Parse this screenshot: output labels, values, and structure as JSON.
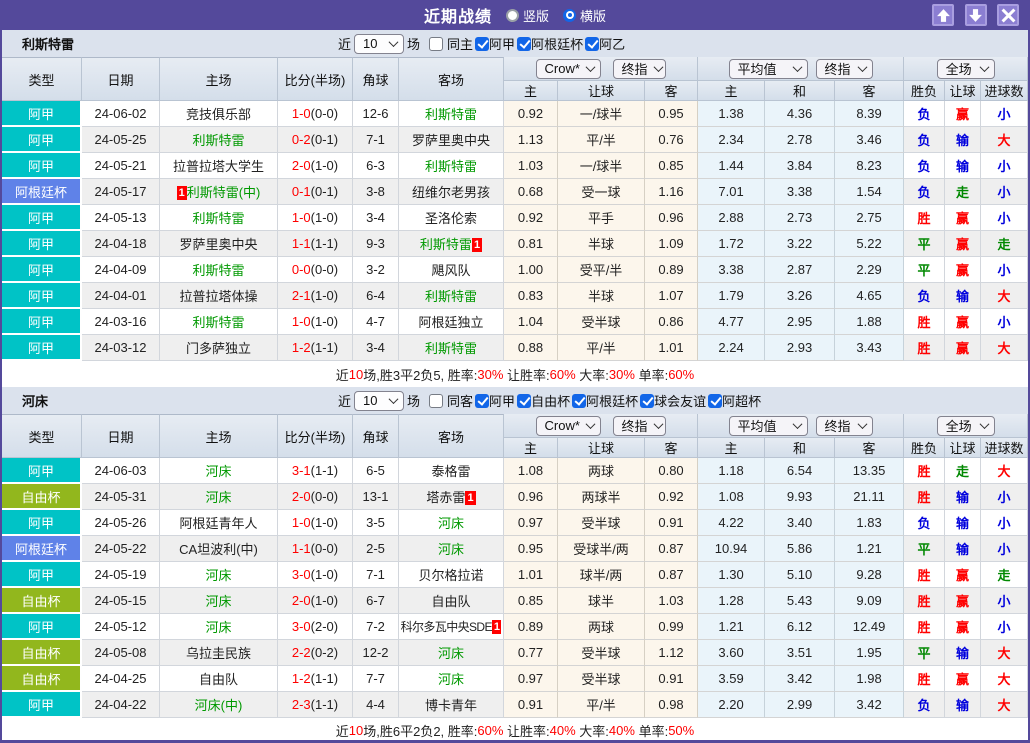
{
  "titlebar": {
    "title": "近期战绩",
    "radios": [
      {
        "label": "竖版",
        "checked": false
      },
      {
        "label": "横版",
        "checked": true
      }
    ],
    "buttons": {
      "up": "up-arrow",
      "down": "down-arrow",
      "close": "close-x"
    }
  },
  "palette": {
    "accent_purple": "#54499b",
    "league_cyan": "#00c3c6",
    "league_blue": "#5f82e8",
    "league_olive": "#92b71d",
    "red": "#ff0000",
    "blue": "#0000dd",
    "green": "#008800",
    "team_green": "#009900"
  },
  "table_header": {
    "league": "类型",
    "date": "日期",
    "home": "主场",
    "score": "比分(半场)",
    "corner": "角球",
    "away": "客场",
    "crow_cols": [
      "主",
      "让球",
      "客"
    ],
    "avg_cols": [
      "主",
      "和",
      "客"
    ],
    "res_cols": [
      "胜负",
      "让球",
      "进球数"
    ]
  },
  "filters_common": {
    "prefix": "近",
    "count": "10",
    "suffix": "场"
  },
  "selects": {
    "odds_source": "Crow*",
    "odds_stage": "终指",
    "euro_source": "平均值",
    "euro_stage": "终指",
    "scope": "全场"
  },
  "sections": [
    {
      "team": "利斯特雷",
      "checkboxes": [
        {
          "label": "同主",
          "checked": false
        },
        {
          "label": "阿甲",
          "checked": true
        },
        {
          "label": "阿根廷杯",
          "checked": true
        },
        {
          "label": "阿乙",
          "checked": true
        }
      ],
      "rows": [
        {
          "league": "阿甲",
          "lc": "league_cyan",
          "date": "24-06-02",
          "home": {
            "name": "竞技俱乐部"
          },
          "score": "1-0",
          "half": "(0-0)",
          "corner": "12-6",
          "away": {
            "name": "利斯特雷",
            "hl": true
          },
          "crow": [
            "0.92",
            "一/球半",
            "0.95"
          ],
          "avg": [
            "1.38",
            "4.36",
            "8.39"
          ],
          "res": [
            [
              "负",
              "blue"
            ],
            [
              "赢",
              "red"
            ],
            [
              "小",
              "blue"
            ]
          ]
        },
        {
          "league": "阿甲",
          "lc": "league_cyan",
          "date": "24-05-25",
          "home": {
            "name": "利斯特雷",
            "hl": true
          },
          "score": "0-2",
          "half": "(0-1)",
          "corner": "7-1",
          "away": {
            "name": "罗萨里奥中央"
          },
          "crow": [
            "1.13",
            "平/半",
            "0.76"
          ],
          "avg": [
            "2.34",
            "2.78",
            "3.46"
          ],
          "res": [
            [
              "负",
              "blue"
            ],
            [
              "输",
              "blue"
            ],
            [
              "大",
              "red"
            ]
          ]
        },
        {
          "league": "阿甲",
          "lc": "league_cyan",
          "date": "24-05-21",
          "home": {
            "name": "拉普拉塔大学生"
          },
          "score": "2-0",
          "half": "(1-0)",
          "corner": "6-3",
          "away": {
            "name": "利斯特雷",
            "hl": true
          },
          "crow": [
            "1.03",
            "一/球半",
            "0.85"
          ],
          "avg": [
            "1.44",
            "3.84",
            "8.23"
          ],
          "res": [
            [
              "负",
              "blue"
            ],
            [
              "输",
              "blue"
            ],
            [
              "小",
              "blue"
            ]
          ]
        },
        {
          "league": "阿根廷杯",
          "lc": "league_blue",
          "date": "24-05-17",
          "home": {
            "name": "利斯特雷(中)",
            "hl": true,
            "badge_before": "1"
          },
          "score": "0-1",
          "half": "(0-1)",
          "corner": "3-8",
          "away": {
            "name": "纽维尔老男孩"
          },
          "crow": [
            "0.68",
            "受一球",
            "1.16"
          ],
          "avg": [
            "7.01",
            "3.38",
            "1.54"
          ],
          "res": [
            [
              "负",
              "blue"
            ],
            [
              "走",
              "green"
            ],
            [
              "小",
              "blue"
            ]
          ]
        },
        {
          "league": "阿甲",
          "lc": "league_cyan",
          "date": "24-05-13",
          "home": {
            "name": "利斯特雷",
            "hl": true
          },
          "score": "1-0",
          "half": "(1-0)",
          "corner": "3-4",
          "away": {
            "name": "圣洛伦索"
          },
          "crow": [
            "0.92",
            "平手",
            "0.96"
          ],
          "avg": [
            "2.88",
            "2.73",
            "2.75"
          ],
          "res": [
            [
              "胜",
              "red"
            ],
            [
              "赢",
              "red"
            ],
            [
              "小",
              "blue"
            ]
          ]
        },
        {
          "league": "阿甲",
          "lc": "league_cyan",
          "date": "24-04-18",
          "home": {
            "name": "罗萨里奥中央"
          },
          "score": "1-1",
          "half": "(1-1)",
          "corner": "9-3",
          "away": {
            "name": "利斯特雷",
            "hl": true,
            "badge_after": "1"
          },
          "crow": [
            "0.81",
            "半球",
            "1.09"
          ],
          "avg": [
            "1.72",
            "3.22",
            "5.22"
          ],
          "res": [
            [
              "平",
              "green"
            ],
            [
              "赢",
              "red"
            ],
            [
              "走",
              "green"
            ]
          ]
        },
        {
          "league": "阿甲",
          "lc": "league_cyan",
          "date": "24-04-09",
          "home": {
            "name": "利斯特雷",
            "hl": true
          },
          "score": "0-0",
          "half": "(0-0)",
          "corner": "3-2",
          "away": {
            "name": "飓风队"
          },
          "crow": [
            "1.00",
            "受平/半",
            "0.89"
          ],
          "avg": [
            "3.38",
            "2.87",
            "2.29"
          ],
          "res": [
            [
              "平",
              "green"
            ],
            [
              "赢",
              "red"
            ],
            [
              "小",
              "blue"
            ]
          ]
        },
        {
          "league": "阿甲",
          "lc": "league_cyan",
          "date": "24-04-01",
          "home": {
            "name": "拉普拉塔体操"
          },
          "score": "2-1",
          "half": "(1-0)",
          "corner": "6-4",
          "away": {
            "name": "利斯特雷",
            "hl": true
          },
          "crow": [
            "0.83",
            "半球",
            "1.07"
          ],
          "avg": [
            "1.79",
            "3.26",
            "4.65"
          ],
          "res": [
            [
              "负",
              "blue"
            ],
            [
              "输",
              "blue"
            ],
            [
              "大",
              "red"
            ]
          ]
        },
        {
          "league": "阿甲",
          "lc": "league_cyan",
          "date": "24-03-16",
          "home": {
            "name": "利斯特雷",
            "hl": true
          },
          "score": "1-0",
          "half": "(1-0)",
          "corner": "4-7",
          "away": {
            "name": "阿根廷独立"
          },
          "crow": [
            "1.04",
            "受半球",
            "0.86"
          ],
          "avg": [
            "4.77",
            "2.95",
            "1.88"
          ],
          "res": [
            [
              "胜",
              "red"
            ],
            [
              "赢",
              "red"
            ],
            [
              "小",
              "blue"
            ]
          ]
        },
        {
          "league": "阿甲",
          "lc": "league_cyan",
          "date": "24-03-12",
          "home": {
            "name": "门多萨独立"
          },
          "score": "1-2",
          "half": "(1-1)",
          "corner": "3-4",
          "away": {
            "name": "利斯特雷",
            "hl": true
          },
          "crow": [
            "0.88",
            "平/半",
            "1.01"
          ],
          "avg": [
            "2.24",
            "2.93",
            "3.43"
          ],
          "res": [
            [
              "胜",
              "red"
            ],
            [
              "赢",
              "red"
            ],
            [
              "大",
              "red"
            ]
          ]
        }
      ],
      "summary": [
        {
          "t": "近",
          "c": "black"
        },
        {
          "t": "10",
          "c": "red"
        },
        {
          "t": "场,胜3平2负5, 胜率:",
          "c": "black"
        },
        {
          "t": "30%",
          "c": "red"
        },
        {
          "t": " 让胜率:",
          "c": "black"
        },
        {
          "t": "60%",
          "c": "red"
        },
        {
          "t": " 大率:",
          "c": "black"
        },
        {
          "t": "30%",
          "c": "red"
        },
        {
          "t": " 单率:",
          "c": "black"
        },
        {
          "t": "60%",
          "c": "red"
        }
      ]
    },
    {
      "team": "河床",
      "checkboxes": [
        {
          "label": "同客",
          "checked": false
        },
        {
          "label": "阿甲",
          "checked": true
        },
        {
          "label": "自由杯",
          "checked": true
        },
        {
          "label": "阿根廷杯",
          "checked": true
        },
        {
          "label": "球会友谊",
          "checked": true
        },
        {
          "label": "阿超杯",
          "checked": true
        }
      ],
      "rows": [
        {
          "league": "阿甲",
          "lc": "league_cyan",
          "date": "24-06-03",
          "home": {
            "name": "河床",
            "hl": true
          },
          "score": "3-1",
          "half": "(1-1)",
          "corner": "6-5",
          "away": {
            "name": "泰格雷"
          },
          "crow": [
            "1.08",
            "两球",
            "0.80"
          ],
          "avg": [
            "1.18",
            "6.54",
            "13.35"
          ],
          "res": [
            [
              "胜",
              "red"
            ],
            [
              "走",
              "green"
            ],
            [
              "大",
              "red"
            ]
          ]
        },
        {
          "league": "自由杯",
          "lc": "league_olive",
          "date": "24-05-31",
          "home": {
            "name": "河床",
            "hl": true
          },
          "score": "2-0",
          "half": "(0-0)",
          "corner": "13-1",
          "away": {
            "name": "塔赤雷",
            "badge_after": "1"
          },
          "crow": [
            "0.96",
            "两球半",
            "0.92"
          ],
          "avg": [
            "1.08",
            "9.93",
            "21.11"
          ],
          "res": [
            [
              "胜",
              "red"
            ],
            [
              "输",
              "blue"
            ],
            [
              "小",
              "blue"
            ]
          ]
        },
        {
          "league": "阿甲",
          "lc": "league_cyan",
          "date": "24-05-26",
          "home": {
            "name": "阿根廷青年人"
          },
          "score": "1-0",
          "half": "(1-0)",
          "corner": "3-5",
          "away": {
            "name": "河床",
            "hl": true
          },
          "crow": [
            "0.97",
            "受半球",
            "0.91"
          ],
          "avg": [
            "4.22",
            "3.40",
            "1.83"
          ],
          "res": [
            [
              "负",
              "blue"
            ],
            [
              "输",
              "blue"
            ],
            [
              "小",
              "blue"
            ]
          ]
        },
        {
          "league": "阿根廷杯",
          "lc": "league_blue",
          "date": "24-05-22",
          "home": {
            "name": "CA坦波利(中)"
          },
          "score": "1-1",
          "half": "(0-0)",
          "corner": "2-5",
          "away": {
            "name": "河床",
            "hl": true
          },
          "crow": [
            "0.95",
            "受球半/两",
            "0.87"
          ],
          "avg": [
            "10.94",
            "5.86",
            "1.21"
          ],
          "res": [
            [
              "平",
              "green"
            ],
            [
              "输",
              "blue"
            ],
            [
              "小",
              "blue"
            ]
          ]
        },
        {
          "league": "阿甲",
          "lc": "league_cyan",
          "date": "24-05-19",
          "home": {
            "name": "河床",
            "hl": true
          },
          "score": "3-0",
          "half": "(1-0)",
          "corner": "7-1",
          "away": {
            "name": "贝尔格拉诺"
          },
          "crow": [
            "1.01",
            "球半/两",
            "0.87"
          ],
          "avg": [
            "1.30",
            "5.10",
            "9.28"
          ],
          "res": [
            [
              "胜",
              "red"
            ],
            [
              "赢",
              "red"
            ],
            [
              "走",
              "green"
            ]
          ]
        },
        {
          "league": "自由杯",
          "lc": "league_olive",
          "date": "24-05-15",
          "home": {
            "name": "河床",
            "hl": true
          },
          "score": "2-0",
          "half": "(1-0)",
          "corner": "6-7",
          "away": {
            "name": "自由队"
          },
          "crow": [
            "0.85",
            "球半",
            "1.03"
          ],
          "avg": [
            "1.28",
            "5.43",
            "9.09"
          ],
          "res": [
            [
              "胜",
              "red"
            ],
            [
              "赢",
              "red"
            ],
            [
              "小",
              "blue"
            ]
          ]
        },
        {
          "league": "阿甲",
          "lc": "league_cyan",
          "date": "24-05-12",
          "home": {
            "name": "河床",
            "hl": true
          },
          "score": "3-0",
          "half": "(2-0)",
          "corner": "7-2",
          "away": {
            "name": "科尔多瓦中央SDE",
            "badge_after": "1"
          },
          "crow": [
            "0.89",
            "两球",
            "0.99"
          ],
          "avg": [
            "1.21",
            "6.12",
            "12.49"
          ],
          "res": [
            [
              "胜",
              "red"
            ],
            [
              "赢",
              "red"
            ],
            [
              "小",
              "blue"
            ]
          ]
        },
        {
          "league": "自由杯",
          "lc": "league_olive",
          "date": "24-05-08",
          "home": {
            "name": "乌拉圭民族"
          },
          "score": "2-2",
          "half": "(0-2)",
          "corner": "12-2",
          "away": {
            "name": "河床",
            "hl": true
          },
          "crow": [
            "0.77",
            "受半球",
            "1.12"
          ],
          "avg": [
            "3.60",
            "3.51",
            "1.95"
          ],
          "res": [
            [
              "平",
              "green"
            ],
            [
              "输",
              "blue"
            ],
            [
              "大",
              "red"
            ]
          ]
        },
        {
          "league": "自由杯",
          "lc": "league_olive",
          "date": "24-04-25",
          "home": {
            "name": "自由队"
          },
          "score": "1-2",
          "half": "(1-1)",
          "corner": "7-7",
          "away": {
            "name": "河床",
            "hl": true
          },
          "crow": [
            "0.97",
            "受半球",
            "0.91"
          ],
          "avg": [
            "3.59",
            "3.42",
            "1.98"
          ],
          "res": [
            [
              "胜",
              "red"
            ],
            [
              "赢",
              "red"
            ],
            [
              "大",
              "red"
            ]
          ]
        },
        {
          "league": "阿甲",
          "lc": "league_cyan",
          "date": "24-04-22",
          "home": {
            "name": "河床(中)",
            "hl": true
          },
          "score": "2-3",
          "half": "(1-1)",
          "corner": "4-4",
          "away": {
            "name": "博卡青年"
          },
          "crow": [
            "0.91",
            "平/半",
            "0.98"
          ],
          "avg": [
            "2.20",
            "2.99",
            "3.42"
          ],
          "res": [
            [
              "负",
              "blue"
            ],
            [
              "输",
              "blue"
            ],
            [
              "大",
              "red"
            ]
          ]
        }
      ],
      "summary": [
        {
          "t": "近",
          "c": "black"
        },
        {
          "t": "10",
          "c": "red"
        },
        {
          "t": "场,胜6平2负2, 胜率:",
          "c": "black"
        },
        {
          "t": "60%",
          "c": "red"
        },
        {
          "t": " 让胜率:",
          "c": "black"
        },
        {
          "t": "40%",
          "c": "red"
        },
        {
          "t": " 大率:",
          "c": "black"
        },
        {
          "t": "40%",
          "c": "red"
        },
        {
          "t": " 单率:",
          "c": "black"
        },
        {
          "t": "50%",
          "c": "red"
        }
      ]
    }
  ]
}
